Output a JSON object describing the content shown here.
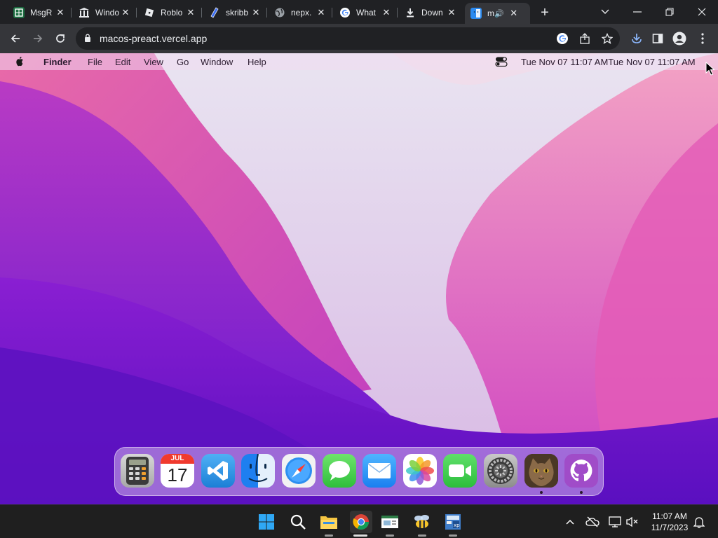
{
  "browser": {
    "tabs": [
      {
        "title": "MsgR",
        "icon": "spreadsheet-icon",
        "color": "#1d6f42"
      },
      {
        "title": "Windo",
        "icon": "museum-icon",
        "color": "#e8eaed"
      },
      {
        "title": "Roblo",
        "icon": "roblox-icon",
        "color": "#e8eaed"
      },
      {
        "title": "skribb",
        "icon": "pencil-icon",
        "color": "#3b6cf2"
      },
      {
        "title": "nepx.",
        "icon": "globe-icon",
        "color": "#9aa0a6"
      },
      {
        "title": "What",
        "icon": "google-icon",
        "color": "#4285f4"
      },
      {
        "title": "Down",
        "icon": "download-icon",
        "color": "#e8eaed"
      },
      {
        "title": "m",
        "icon": "finder-icon",
        "color": "#2b8af0",
        "active": true,
        "audio": "speaker-icon"
      }
    ],
    "new_tab": "+",
    "url": "macos-preact.vercel.app"
  },
  "mac": {
    "menu": {
      "app_name": "Finder",
      "items": [
        "File",
        "Edit",
        "View",
        "Go",
        "Window",
        "Help"
      ],
      "clock": "Tue Nov 07  11:07 AMTue Nov 07  11:07 AM"
    },
    "dock": {
      "calendar_month": "JUL",
      "calendar_day": "17",
      "apps": [
        {
          "name": "Calculator",
          "icon": "calculator-icon",
          "running": false
        },
        {
          "name": "Calendar",
          "icon": "calendar-icon",
          "running": false
        },
        {
          "name": "VS Code",
          "icon": "vscode-icon",
          "running": false
        },
        {
          "name": "Finder",
          "icon": "finder-icon",
          "running": false
        },
        {
          "name": "Safari",
          "icon": "safari-icon",
          "running": false
        },
        {
          "name": "Messages",
          "icon": "messages-icon",
          "running": false
        },
        {
          "name": "Mail",
          "icon": "mail-icon",
          "running": false
        },
        {
          "name": "Photos",
          "icon": "photos-icon",
          "running": false
        },
        {
          "name": "FaceTime",
          "icon": "facetime-icon",
          "running": false
        },
        {
          "name": "System Preferences",
          "icon": "settings-icon",
          "running": false
        },
        {
          "name": "Cat",
          "icon": "cat-photo-icon",
          "running": true
        },
        {
          "name": "GitHub",
          "icon": "github-icon",
          "running": true
        }
      ]
    }
  },
  "taskbar": {
    "time": "11:07 AM",
    "date": "11/7/2023"
  }
}
